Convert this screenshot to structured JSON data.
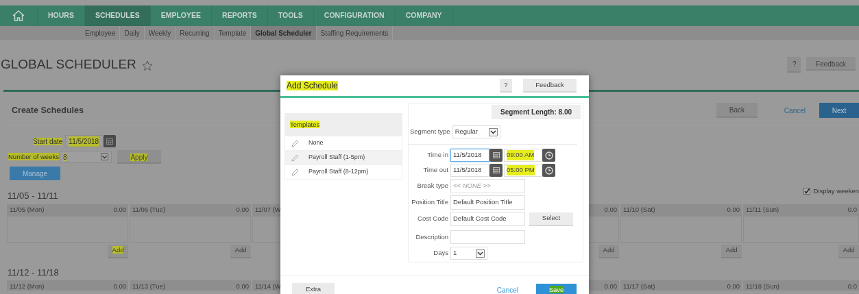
{
  "top_nav": [
    {
      "label": "HOURS",
      "selected": false
    },
    {
      "label": "SCHEDULES",
      "selected": true
    },
    {
      "label": "EMPLOYEE",
      "selected": false
    },
    {
      "label": "REPORTS",
      "selected": false
    },
    {
      "label": "TOOLS",
      "selected": false
    },
    {
      "label": "CONFIGURATION",
      "selected": false
    },
    {
      "label": "COMPANY",
      "selected": false
    }
  ],
  "sub_nav": [
    {
      "label": "Employee",
      "selected": false
    },
    {
      "label": "Daily",
      "selected": false
    },
    {
      "label": "Weekly",
      "selected": false
    },
    {
      "label": "Recurring",
      "selected": false
    },
    {
      "label": "Template",
      "selected": false
    },
    {
      "label": "Global Scheduler",
      "selected": true
    },
    {
      "label": "Staffing Requirements",
      "selected": false
    }
  ],
  "page": {
    "title": "GLOBAL SCHEDULER",
    "favorite": false,
    "help": "?",
    "feedback": "Feedback"
  },
  "section": {
    "title": "Create Schedules",
    "back": "Back",
    "cancel": "Cancel",
    "next": "Next"
  },
  "form": {
    "start_date": {
      "label": "Start date",
      "value": "11/5/2018",
      "highlighted": true
    },
    "number_of_weeks": {
      "label": "Number of weeks",
      "value": "8",
      "highlighted": true
    },
    "apply": {
      "label": "Apply",
      "highlighted": true
    },
    "manage": "Manage"
  },
  "display_weekends": {
    "label": "Display weeken",
    "checked": true
  },
  "weeks": [
    {
      "range": "11/05 - 11/11",
      "days": [
        {
          "kind": "day",
          "label": "11/05 (Mon)",
          "hours": "0.00",
          "add": "Add",
          "add_highlighted": true
        },
        {
          "kind": "day",
          "label": "11/06 (Tue)",
          "hours": "0.00",
          "add": "Add",
          "add_highlighted": false
        },
        {
          "kind": "day",
          "label": "11/07 (W"
        },
        {
          "kind": "covered"
        },
        {
          "kind": "day",
          "hours": "0.00",
          "add": "Add",
          "add_highlighted": false
        },
        {
          "kind": "day",
          "label": "11/10 (Sat)",
          "hours": "0.00",
          "add": "Add",
          "add_highlighted": false
        },
        {
          "kind": "day",
          "label": "11/11 (Sun)",
          "hours": "0.0",
          "add": "Add",
          "add_highlighted": false
        }
      ]
    },
    {
      "range": "11/12 - 11/18",
      "days": [
        {
          "kind": "day",
          "label": "11/12 (Mon)",
          "hours": "0.00"
        },
        {
          "kind": "day",
          "label": "11/13 (Tue)",
          "hours": "0.00"
        },
        {
          "kind": "day",
          "label": "11/14 (W"
        },
        {
          "kind": "covered"
        },
        {
          "kind": "day",
          "hours": "0.00"
        },
        {
          "kind": "day",
          "label": "11/17 (Sat)",
          "hours": "0.00"
        },
        {
          "kind": "day",
          "label": "11/18 (Sun)",
          "hours": "0.0"
        }
      ]
    }
  ],
  "modal": {
    "title": "Add Schedule",
    "title_highlighted": true,
    "help": "?",
    "feedback": "Feedback",
    "templates": {
      "title": "Templates",
      "title_highlighted": true,
      "items": [
        {
          "label": "None",
          "selected": false
        },
        {
          "label": "Payroll Staff (1-5pm)",
          "selected": true
        },
        {
          "label": "Payroll Staff (8-12pm)",
          "selected": false
        }
      ]
    },
    "segment_length": "Segment Length: 8.00",
    "segment_type": {
      "label": "Segment type",
      "value": "Regular"
    },
    "time_in": {
      "label": "Time in",
      "date": "11/5/2018",
      "time": "09:00 AM",
      "focused": true,
      "time_highlighted": true
    },
    "time_out": {
      "label": "Time out",
      "date": "11/5/2018",
      "time": "05:00 PM",
      "focused": false,
      "time_highlighted": true
    },
    "break_type": {
      "label": "Break type",
      "placeholder": "<< NONE >>"
    },
    "position_title": {
      "label": "Position Title",
      "value": "Default Position Title"
    },
    "cost_code": {
      "label": "Cost Code",
      "value": "Default Cost Code",
      "button": "Select"
    },
    "description": {
      "label": "Description"
    },
    "days": {
      "label": "Days",
      "value": "1"
    },
    "extra": "Extra",
    "cancel": "Cancel",
    "save": "Save",
    "save_highlighted": true
  }
}
